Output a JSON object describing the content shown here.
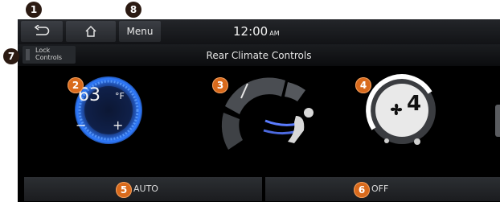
{
  "topbar": {
    "menu_label": "Menu",
    "clock_time": "12:00",
    "clock_ampm": "AM"
  },
  "subbar": {
    "lock_label_line1": "Lock",
    "lock_label_line2": "Controls",
    "title": "Rear Climate Controls"
  },
  "temperature": {
    "value": "63",
    "unit": "°F",
    "minus": "−",
    "plus": "+"
  },
  "fan": {
    "level": "4"
  },
  "bottom": {
    "auto_label": "AUTO",
    "off_label": "OFF"
  },
  "callouts": {
    "back": "1",
    "temperature": "2",
    "mode": "3",
    "fan": "4",
    "auto": "5",
    "off": "6",
    "lock": "7",
    "menu": "8"
  },
  "colors": {
    "orange": "#d96a1c",
    "blue_glow": "#2f7bff",
    "screen_bg": "#000000"
  }
}
